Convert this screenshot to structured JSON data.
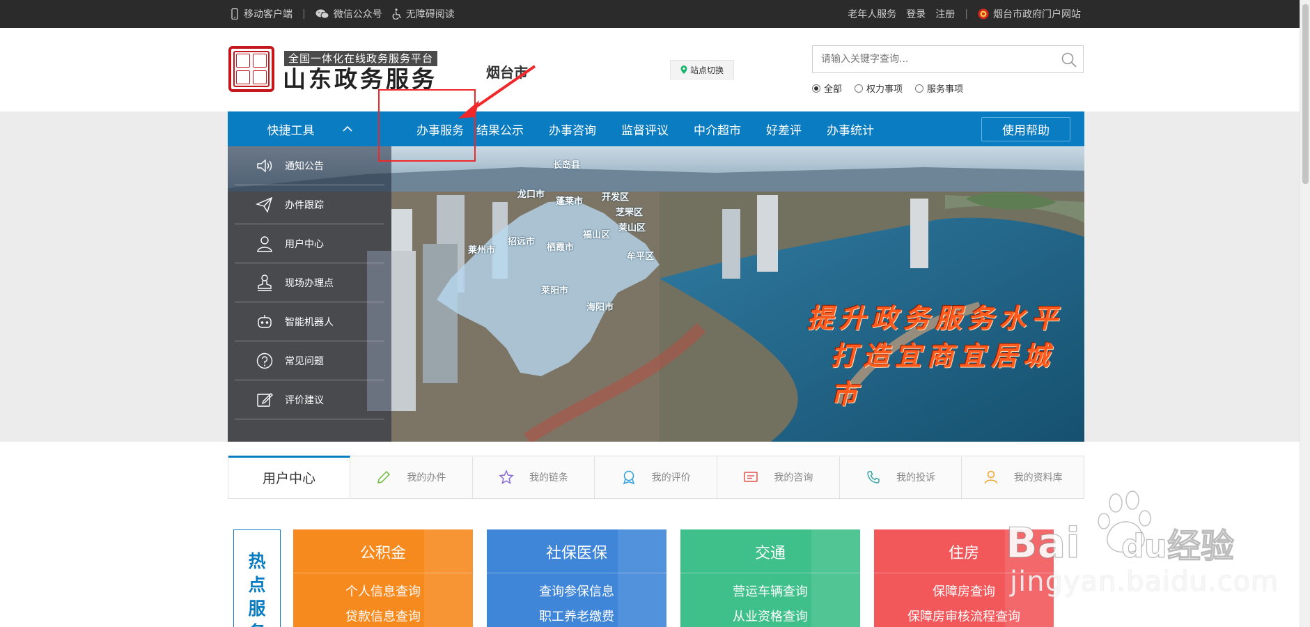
{
  "topbar": {
    "left": [
      {
        "label": "移动客户端",
        "icon": "mobile-icon"
      },
      {
        "label": "微信公众号",
        "icon": "wechat-icon"
      },
      {
        "label": "无障碍阅读",
        "icon": "accessibility-icon"
      }
    ],
    "separator": "|",
    "right": {
      "elderly": "老年人服务",
      "login": "登录",
      "register": "注册",
      "gov_site": "烟台市政府门户网站"
    }
  },
  "header": {
    "subtitle": "全国一体化在线政务服务平台",
    "title": "山东政务服务",
    "city": "烟台市",
    "station_switch": "站点切换",
    "search_placeholder": "请输入关键字查询...",
    "scopes": [
      "全部",
      "权力事项",
      "服务事项"
    ],
    "selected_scope": "全部"
  },
  "nav": {
    "quick_tools": "快捷工具",
    "items": [
      "办事服务",
      "结果公示",
      "办事咨询",
      "监督评议",
      "中介超市",
      "好差评",
      "办事统计"
    ],
    "help": "使用帮助"
  },
  "sidebar": {
    "items": [
      {
        "label": "通知公告",
        "icon": "speaker-icon"
      },
      {
        "label": "办件跟踪",
        "icon": "paper-plane-icon"
      },
      {
        "label": "用户中心",
        "icon": "user-icon"
      },
      {
        "label": "现场办理点",
        "icon": "stamp-icon"
      },
      {
        "label": "智能机器人",
        "icon": "robot-icon"
      },
      {
        "label": "常见问题",
        "icon": "question-icon"
      },
      {
        "label": "评价建议",
        "icon": "edit-icon"
      }
    ]
  },
  "banner": {
    "slogan_line1": "提升政务服务水平",
    "slogan_line2": "打造宜商宜居城市",
    "map_labels": [
      "长岛县",
      "龙口市",
      "蓬莱市",
      "开发区",
      "芝罘区",
      "莱山区",
      "福山区",
      "招远市",
      "栖霞市",
      "莱州市",
      "牟平区",
      "莱阳市",
      "海阳市"
    ]
  },
  "user_center": {
    "title": "用户中心",
    "items": [
      {
        "label": "我的办件",
        "icon": "pencil-icon",
        "color": "#6bbf3a"
      },
      {
        "label": "我的链条",
        "icon": "star-icon",
        "color": "#8a6cd6"
      },
      {
        "label": "我的评价",
        "icon": "badge-icon",
        "color": "#2c9fd6"
      },
      {
        "label": "我的咨询",
        "icon": "message-icon",
        "color": "#e2514b"
      },
      {
        "label": "我的投诉",
        "icon": "phone-icon",
        "color": "#2aa0a0"
      },
      {
        "label": "我的资料库",
        "icon": "person-icon",
        "color": "#f2a32b"
      }
    ]
  },
  "hot_services": {
    "label": [
      "热",
      "点",
      "服",
      "务"
    ],
    "cards": [
      {
        "title": "公积金",
        "links": [
          "个人信息查询",
          "贷款信息查询"
        ],
        "color": "#f78a1e"
      },
      {
        "title": "社保医保",
        "links": [
          "查询参保信息",
          "职工养老缴费"
        ],
        "color": "#3f85d8"
      },
      {
        "title": "交通",
        "links": [
          "营运车辆查询",
          "从业资格查询"
        ],
        "color": "#3fbf8a"
      },
      {
        "title": "住房",
        "links": [
          "保障房查询",
          "保障房审核流程查询"
        ],
        "color": "#f2575a"
      }
    ]
  },
  "watermark": {
    "brand": "Bai",
    "brand2": "du",
    "product": "经验",
    "url": "jingyan.baidu.com"
  },
  "colors": {
    "nav_blue": "#0a7dc2",
    "topbar": "#2b2b2b",
    "annotation_red": "#f0282a"
  }
}
